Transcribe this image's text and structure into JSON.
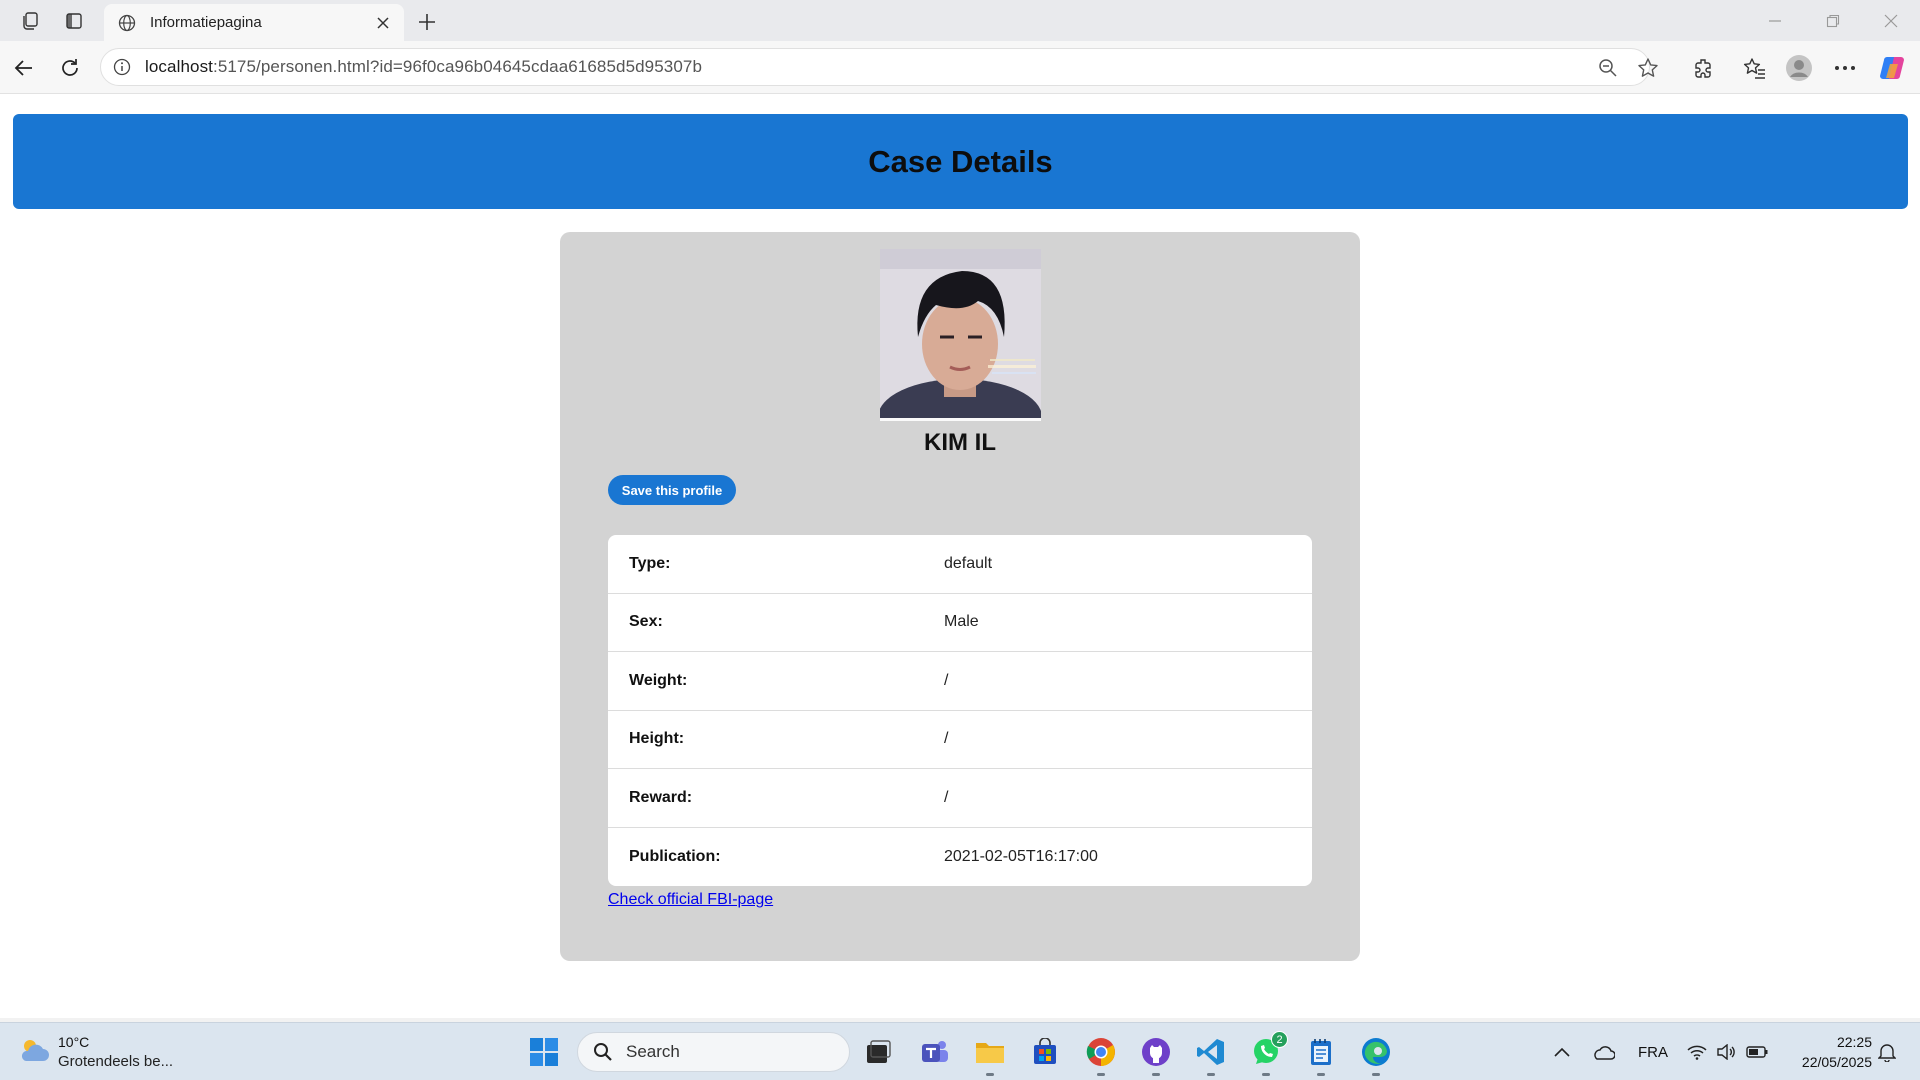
{
  "browser": {
    "tab_title": "Informatiepagina",
    "url_host": "localhost",
    "url_rest": ":5175/personen.html?id=96f0ca96b04645cdaa61685d5d95307b"
  },
  "page": {
    "header_title": "Case Details",
    "person_name": "KIM IL",
    "save_button": "Save this profile",
    "details": [
      {
        "label": "Type:",
        "value": "default"
      },
      {
        "label": "Sex:",
        "value": "Male"
      },
      {
        "label": "Weight:",
        "value": "/"
      },
      {
        "label": "Height:",
        "value": "/"
      },
      {
        "label": "Reward:",
        "value": "/"
      },
      {
        "label": "Publication:",
        "value": "2021-02-05T16:17:00"
      }
    ],
    "fbi_link": "Check official FBI-page"
  },
  "taskbar": {
    "weather_temp": "10°C",
    "weather_desc": "Grotendeels be...",
    "search_placeholder": "Search",
    "language": "FRA",
    "time": "22:25",
    "date": "22/05/2025",
    "whatsapp_badge": "2"
  },
  "colors": {
    "header_bg": "#1976d2",
    "card_bg": "#d3d3d3",
    "button_bg": "#1976d2",
    "link": "#0000ee"
  }
}
